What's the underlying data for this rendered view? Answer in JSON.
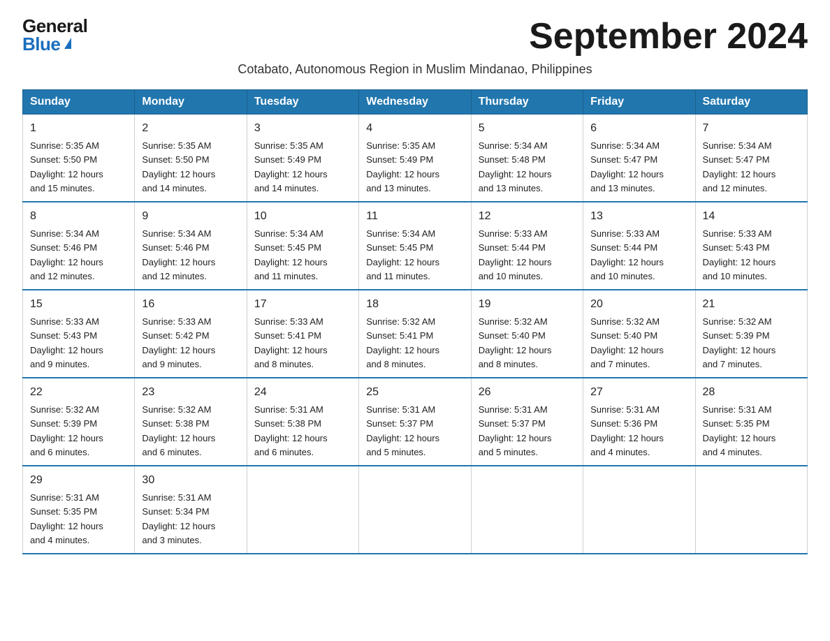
{
  "logo": {
    "general": "General",
    "blue": "Blue"
  },
  "title": "September 2024",
  "subtitle": "Cotabato, Autonomous Region in Muslim Mindanao, Philippines",
  "days_of_week": [
    "Sunday",
    "Monday",
    "Tuesday",
    "Wednesday",
    "Thursday",
    "Friday",
    "Saturday"
  ],
  "weeks": [
    [
      {
        "day": "1",
        "sunrise": "5:35 AM",
        "sunset": "5:50 PM",
        "daylight": "12 hours and 15 minutes."
      },
      {
        "day": "2",
        "sunrise": "5:35 AM",
        "sunset": "5:50 PM",
        "daylight": "12 hours and 14 minutes."
      },
      {
        "day": "3",
        "sunrise": "5:35 AM",
        "sunset": "5:49 PM",
        "daylight": "12 hours and 14 minutes."
      },
      {
        "day": "4",
        "sunrise": "5:35 AM",
        "sunset": "5:49 PM",
        "daylight": "12 hours and 13 minutes."
      },
      {
        "day": "5",
        "sunrise": "5:34 AM",
        "sunset": "5:48 PM",
        "daylight": "12 hours and 13 minutes."
      },
      {
        "day": "6",
        "sunrise": "5:34 AM",
        "sunset": "5:47 PM",
        "daylight": "12 hours and 13 minutes."
      },
      {
        "day": "7",
        "sunrise": "5:34 AM",
        "sunset": "5:47 PM",
        "daylight": "12 hours and 12 minutes."
      }
    ],
    [
      {
        "day": "8",
        "sunrise": "5:34 AM",
        "sunset": "5:46 PM",
        "daylight": "12 hours and 12 minutes."
      },
      {
        "day": "9",
        "sunrise": "5:34 AM",
        "sunset": "5:46 PM",
        "daylight": "12 hours and 12 minutes."
      },
      {
        "day": "10",
        "sunrise": "5:34 AM",
        "sunset": "5:45 PM",
        "daylight": "12 hours and 11 minutes."
      },
      {
        "day": "11",
        "sunrise": "5:34 AM",
        "sunset": "5:45 PM",
        "daylight": "12 hours and 11 minutes."
      },
      {
        "day": "12",
        "sunrise": "5:33 AM",
        "sunset": "5:44 PM",
        "daylight": "12 hours and 10 minutes."
      },
      {
        "day": "13",
        "sunrise": "5:33 AM",
        "sunset": "5:44 PM",
        "daylight": "12 hours and 10 minutes."
      },
      {
        "day": "14",
        "sunrise": "5:33 AM",
        "sunset": "5:43 PM",
        "daylight": "12 hours and 10 minutes."
      }
    ],
    [
      {
        "day": "15",
        "sunrise": "5:33 AM",
        "sunset": "5:43 PM",
        "daylight": "12 hours and 9 minutes."
      },
      {
        "day": "16",
        "sunrise": "5:33 AM",
        "sunset": "5:42 PM",
        "daylight": "12 hours and 9 minutes."
      },
      {
        "day": "17",
        "sunrise": "5:33 AM",
        "sunset": "5:41 PM",
        "daylight": "12 hours and 8 minutes."
      },
      {
        "day": "18",
        "sunrise": "5:32 AM",
        "sunset": "5:41 PM",
        "daylight": "12 hours and 8 minutes."
      },
      {
        "day": "19",
        "sunrise": "5:32 AM",
        "sunset": "5:40 PM",
        "daylight": "12 hours and 8 minutes."
      },
      {
        "day": "20",
        "sunrise": "5:32 AM",
        "sunset": "5:40 PM",
        "daylight": "12 hours and 7 minutes."
      },
      {
        "day": "21",
        "sunrise": "5:32 AM",
        "sunset": "5:39 PM",
        "daylight": "12 hours and 7 minutes."
      }
    ],
    [
      {
        "day": "22",
        "sunrise": "5:32 AM",
        "sunset": "5:39 PM",
        "daylight": "12 hours and 6 minutes."
      },
      {
        "day": "23",
        "sunrise": "5:32 AM",
        "sunset": "5:38 PM",
        "daylight": "12 hours and 6 minutes."
      },
      {
        "day": "24",
        "sunrise": "5:31 AM",
        "sunset": "5:38 PM",
        "daylight": "12 hours and 6 minutes."
      },
      {
        "day": "25",
        "sunrise": "5:31 AM",
        "sunset": "5:37 PM",
        "daylight": "12 hours and 5 minutes."
      },
      {
        "day": "26",
        "sunrise": "5:31 AM",
        "sunset": "5:37 PM",
        "daylight": "12 hours and 5 minutes."
      },
      {
        "day": "27",
        "sunrise": "5:31 AM",
        "sunset": "5:36 PM",
        "daylight": "12 hours and 4 minutes."
      },
      {
        "day": "28",
        "sunrise": "5:31 AM",
        "sunset": "5:35 PM",
        "daylight": "12 hours and 4 minutes."
      }
    ],
    [
      {
        "day": "29",
        "sunrise": "5:31 AM",
        "sunset": "5:35 PM",
        "daylight": "12 hours and 4 minutes."
      },
      {
        "day": "30",
        "sunrise": "5:31 AM",
        "sunset": "5:34 PM",
        "daylight": "12 hours and 3 minutes."
      },
      null,
      null,
      null,
      null,
      null
    ]
  ],
  "labels": {
    "sunrise": "Sunrise:",
    "sunset": "Sunset:",
    "daylight": "Daylight:"
  }
}
